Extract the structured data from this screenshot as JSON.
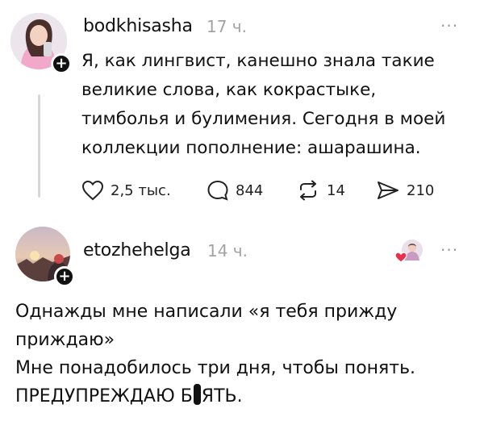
{
  "post1": {
    "username": "bodkhisasha",
    "time": "17 ч.",
    "more": "...",
    "lines": [
      "Я, как лингвист, канешно знала такие",
      "великие слова, как кокрастыке,",
      "тимболья и булимения. Сегодня в моей",
      "коллекции пополнение: ашарашина."
    ],
    "actions": {
      "likes": "2,5 тыс.",
      "comments": "844",
      "reposts": "14",
      "shares": "210"
    }
  },
  "post2": {
    "username": "etozhehelga",
    "time": "14 ч.",
    "more": "...",
    "lines": [
      "Однажды мне написали «я тебя прижду",
      "приждаю»",
      "Мне понадобилось три дня, чтобы понять."
    ],
    "last_line_start": "ПРЕДУПРЕЖДАЮ Б",
    "last_line_end": "ЯТЬ."
  },
  "icons": {
    "plus": "+",
    "heart": "heart-icon",
    "comment": "comment-bubble-icon",
    "repost": "repost-icon",
    "share": "send-icon"
  },
  "colors": {
    "text": "#111111",
    "muted": "#a3a3a3",
    "thread_line": "#d8d8d8",
    "reaction_heart": "#e8314c"
  }
}
